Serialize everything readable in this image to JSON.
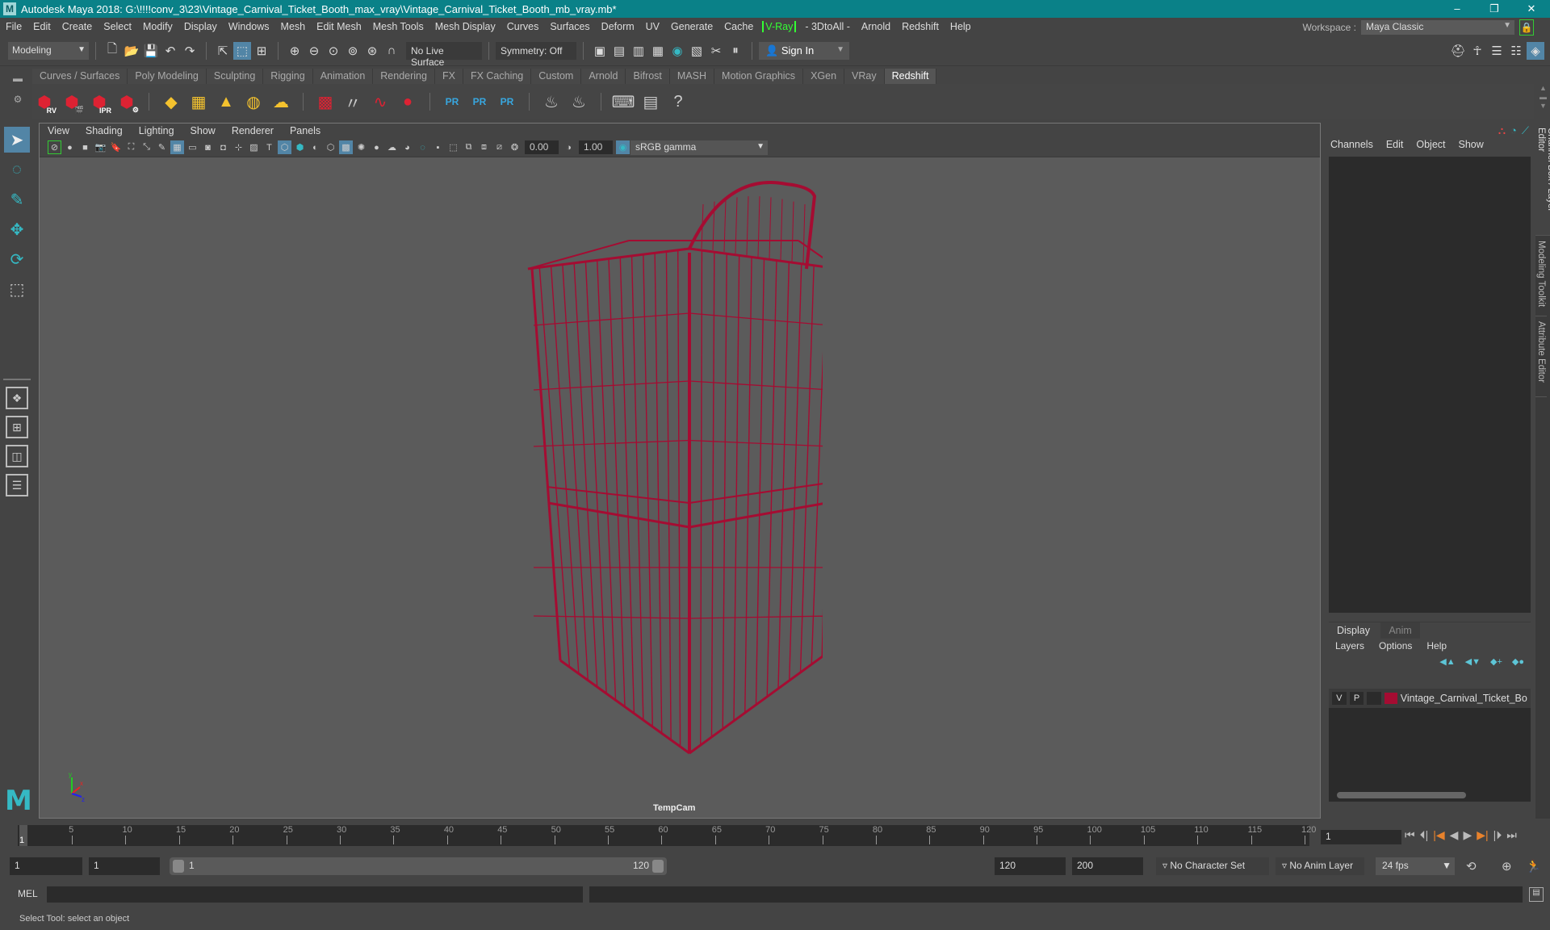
{
  "window": {
    "title": "Autodesk Maya 2018: G:\\!!!!conv_3\\23\\Vintage_Carnival_Ticket_Booth_max_vray\\Vintage_Carnival_Ticket_Booth_mb_vray.mb*",
    "logo": "M",
    "minimize": "–",
    "maximize": "❐",
    "close": "✕"
  },
  "menubar": {
    "items": [
      "File",
      "Edit",
      "Create",
      "Select",
      "Modify",
      "Display",
      "Windows",
      "Mesh",
      "Edit Mesh",
      "Mesh Tools",
      "Mesh Display",
      "Curves",
      "Surfaces",
      "Deform",
      "UV",
      "Generate",
      "Cache"
    ],
    "vray": "V-Ray",
    "items2": [
      "- 3DtoAll -",
      "Arnold",
      "Redshift",
      "Help"
    ],
    "workspace_label": "Workspace :",
    "workspace_value": "Maya Classic"
  },
  "toolbar": {
    "mode": "Modeling",
    "live_surface": "No Live Surface",
    "symmetry": "Symmetry: Off",
    "sign_in": "Sign In"
  },
  "shelf": {
    "tabs": [
      "Curves / Surfaces",
      "Poly Modeling",
      "Sculpting",
      "Rigging",
      "Animation",
      "Rendering",
      "FX",
      "FX Caching",
      "Custom",
      "Arnold",
      "Bifrost",
      "MASH",
      "Motion Graphics",
      "XGen",
      "VRay",
      "Redshift"
    ],
    "active_tab": "Redshift",
    "icons": [
      {
        "name": "rs-render-view",
        "glyph": "⬢",
        "label": "RV",
        "style": "red"
      },
      {
        "name": "rs-render-sequence",
        "glyph": "⬢",
        "label": "🎬",
        "style": "red"
      },
      {
        "name": "rs-ipr",
        "glyph": "⬢",
        "label": "IPR",
        "style": "red"
      },
      {
        "name": "rs-render-settings",
        "glyph": "⬢",
        "label": "⚙",
        "style": "red"
      },
      {
        "name": "rs-area-light",
        "glyph": "◆",
        "label": "",
        "style": "yel"
      },
      {
        "name": "rs-portal-light",
        "glyph": "▦",
        "label": "",
        "style": "yel"
      },
      {
        "name": "rs-physical-light",
        "glyph": "▲",
        "label": "",
        "style": "yel"
      },
      {
        "name": "rs-dome-light",
        "glyph": "◍",
        "label": "",
        "style": "yel"
      },
      {
        "name": "rs-sun-sky",
        "glyph": "☁",
        "label": "",
        "style": "yel"
      },
      {
        "name": "rs-volume",
        "glyph": "▩",
        "label": "",
        "style": "red"
      },
      {
        "name": "rs-hair",
        "glyph": "〃",
        "label": "",
        "style": "gry"
      },
      {
        "name": "rs-rope",
        "glyph": "∿",
        "label": "",
        "style": "red"
      },
      {
        "name": "rs-sphere",
        "glyph": "●",
        "label": "",
        "style": "red"
      },
      {
        "name": "rs-proxy-export",
        "glyph": "PR",
        "label": "",
        "style": "blu"
      },
      {
        "name": "rs-proxy-import",
        "glyph": "PR",
        "label": "",
        "style": "blu"
      },
      {
        "name": "rs-proxy-convert",
        "glyph": "PR",
        "label": "",
        "style": "blu"
      },
      {
        "name": "rs-bake-1",
        "glyph": "♨",
        "label": "",
        "style": "gry"
      },
      {
        "name": "rs-bake-2",
        "glyph": "♨",
        "label": "",
        "style": "gry"
      },
      {
        "name": "rs-script-editor",
        "glyph": "⌨",
        "label": "",
        "style": "gry"
      },
      {
        "name": "rs-log",
        "glyph": "▤",
        "label": "",
        "style": "gry"
      },
      {
        "name": "rs-help",
        "glyph": "?",
        "label": "",
        "style": "gry"
      }
    ]
  },
  "viewport": {
    "menu": [
      "View",
      "Shading",
      "Lighting",
      "Show",
      "Renderer",
      "Panels"
    ],
    "exposure": "0.00",
    "gamma": "1.00",
    "color_space": "sRGB gamma",
    "camera": "TempCam",
    "wire_color": "#a50c32"
  },
  "channel_box": {
    "menu": [
      "Channels",
      "Edit",
      "Object",
      "Show"
    ]
  },
  "layer_editor": {
    "tabs": [
      "Display",
      "Anim"
    ],
    "active_tab": "Display",
    "menu": [
      "Layers",
      "Options",
      "Help"
    ],
    "layers": [
      {
        "visible": "V",
        "playback": "P",
        "color": "#a50c32",
        "name": "Vintage_Carnival_Ticket_Booth"
      }
    ]
  },
  "side_tabs": [
    "Channel Box / Layer Editor",
    "Modeling Toolkit",
    "Attribute Editor"
  ],
  "timeline": {
    "ticks": [
      "5",
      "10",
      "15",
      "20",
      "25",
      "30",
      "35",
      "40",
      "45",
      "50",
      "55",
      "60",
      "65",
      "70",
      "75",
      "80",
      "85",
      "90",
      "95",
      "100",
      "105",
      "110",
      "115",
      "120"
    ],
    "current_frame": "1",
    "current_frame_field": "1"
  },
  "range": {
    "start": "1",
    "playback_start": "1",
    "slider_start": "1",
    "slider_end": "120",
    "playback_end": "120",
    "end": "200",
    "character_set": "No Character Set",
    "anim_layer": "No Anim Layer",
    "fps": "24 fps"
  },
  "command_line": {
    "label": "MEL"
  },
  "status_line": {
    "message": "Select Tool: select an object"
  }
}
